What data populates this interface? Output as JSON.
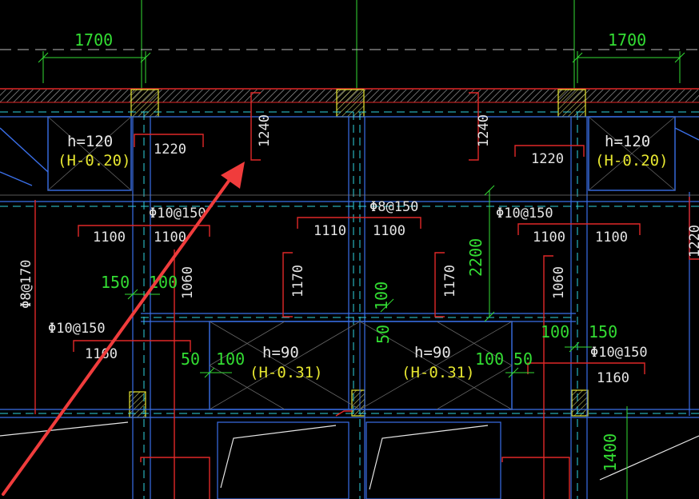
{
  "drawing": {
    "background": "#000000",
    "colors": {
      "red_rebar": "#e02828",
      "green_dim": "#33dd33",
      "blue_beam": "#3a6fe8",
      "cyan_line": "#2fd3e0",
      "yellow_text": "#e6e630",
      "white_text": "#e6e6e6",
      "arrow": "#f03c3c"
    },
    "top_dims": [
      "1700",
      "1700"
    ],
    "slabs": [
      {
        "h": "h=120",
        "elev": "(H-0.20)"
      },
      {
        "h": "h=120",
        "elev": "(H-0.20)"
      },
      {
        "h": "h=90",
        "elev": "(H-0.31)"
      },
      {
        "h": "h=90",
        "elev": "(H-0.31)"
      }
    ],
    "rebar_specs": [
      "Φ10@150",
      "Φ8@150",
      "Φ10@150",
      "Φ8@170",
      "Φ10@150",
      "Φ10@150"
    ],
    "lengths_horizontal": [
      "1220",
      "1220",
      "1100",
      "1100",
      "1110",
      "1100",
      "1100",
      "1100",
      "1160",
      "1160"
    ],
    "lengths_vertical": [
      "1240",
      "1240",
      "1060",
      "1170",
      "1170",
      "1060",
      "1220"
    ],
    "green_dims": [
      "150",
      "100",
      "100",
      "50",
      "2200",
      "100",
      "150",
      "50",
      "100",
      "100",
      "50",
      "1400"
    ],
    "annotation_arrow": {
      "color": "#f03c3c",
      "points_to": "1240"
    }
  }
}
